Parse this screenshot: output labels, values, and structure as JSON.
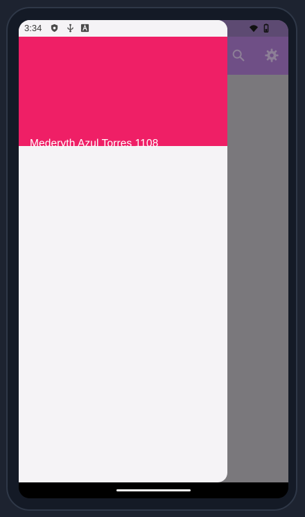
{
  "status_bar": {
    "time": "3:34",
    "left_icons": [
      "shield-icon",
      "usb-icon",
      "text-a-icon"
    ],
    "right_icons": [
      "wifi-icon",
      "battery-icon"
    ]
  },
  "toolbar": {
    "icons": [
      "search-icon",
      "settings-gear-icon"
    ]
  },
  "drawer": {
    "header_name": "Mederyth Azul Torres 1108"
  },
  "colors": {
    "drawer_header": "#ef1f66",
    "drawer_bg": "#f5f3f6",
    "scrim_app_bg": "#7a787c",
    "toolbar": "#6f4f86"
  }
}
